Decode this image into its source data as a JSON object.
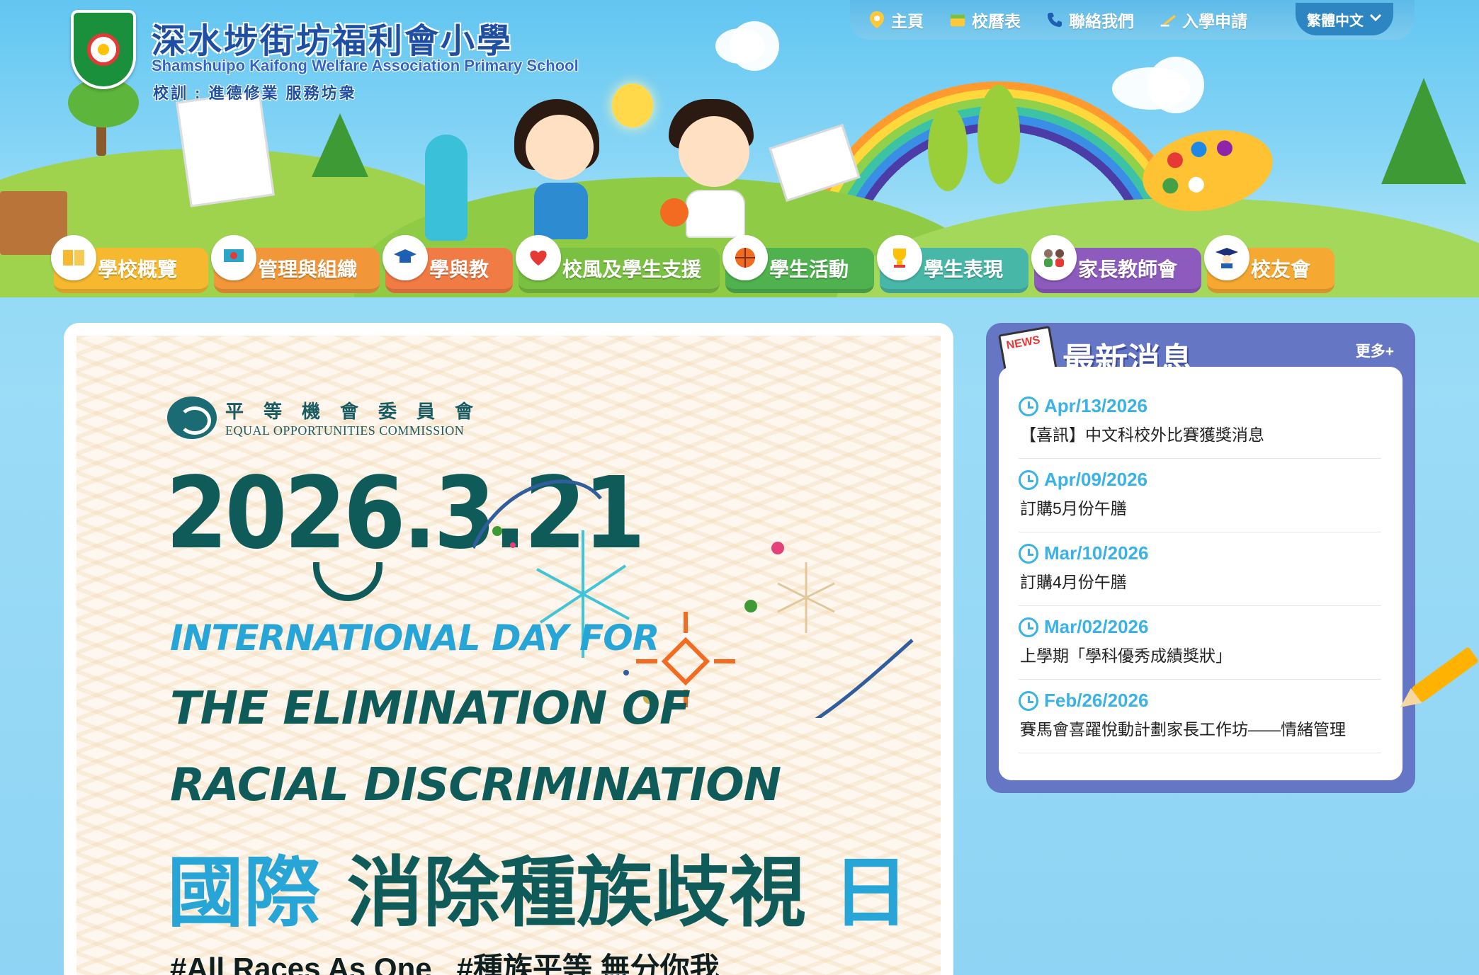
{
  "school": {
    "name_zh": "深水埗街坊福利會小學",
    "name_en": "Shamshuipo Kaifong Welfare Association Primary School",
    "motto": "校訓 : 進德修業 服務坊衆"
  },
  "topnav": {
    "items": [
      {
        "label": "主頁",
        "icon": "home-icon"
      },
      {
        "label": "校曆表",
        "icon": "calendar-icon"
      },
      {
        "label": "聯絡我們",
        "icon": "phone-icon"
      },
      {
        "label": "入學申請",
        "icon": "pencil-icon"
      }
    ],
    "language": "繁體中文"
  },
  "mainnav": {
    "items": [
      {
        "label": "學校概覽",
        "color": "#f5b82e",
        "icon": "book-icon"
      },
      {
        "label": "管理與組織",
        "color": "#f1973a",
        "icon": "board-icon"
      },
      {
        "label": "學與教",
        "color": "#f07b44",
        "icon": "graduation-cap-icon"
      },
      {
        "label": "校風及學生支援",
        "color": "#79c043",
        "icon": "heart-hand-icon"
      },
      {
        "label": "學生活動",
        "color": "#4fb24e",
        "icon": "basketball-icon"
      },
      {
        "label": "學生表現",
        "color": "#47b8a8",
        "icon": "trophy-icon"
      },
      {
        "label": "家長教師會",
        "color": "#8c5bbd",
        "icon": "family-icon"
      },
      {
        "label": "校友會",
        "color": "#f5a832",
        "icon": "alumni-icon"
      }
    ]
  },
  "poster": {
    "org_zh": "平等機會委員會",
    "org_en": "EQUAL OPPORTUNITIES COMMISSION",
    "date": "2026.3.21",
    "line1": "INTERNATIONAL DAY FOR",
    "line2": "THE ELIMINATION OF",
    "line3": "RACIAL DISCRIMINATION",
    "zh_title_a": "國際",
    "zh_title_b": "消除種族歧視",
    "zh_title_c": "日",
    "hashtags": "#All Races As One   #種族平等 無分你我"
  },
  "news": {
    "title": "最新消息",
    "more": "更多+",
    "items": [
      {
        "date": "Apr/13/2026",
        "text": "【喜訊】中文科校外比賽獲獎消息"
      },
      {
        "date": "Apr/09/2026",
        "text": "訂購5月份午膳"
      },
      {
        "date": "Mar/10/2026",
        "text": "訂購4月份午膳"
      },
      {
        "date": "Mar/02/2026",
        "text": "上學期「學科優秀成績獎狀」"
      },
      {
        "date": "Feb/26/2026",
        "text": "賽馬會喜躍悅動計劃家長工作坊——情緒管理"
      }
    ]
  }
}
